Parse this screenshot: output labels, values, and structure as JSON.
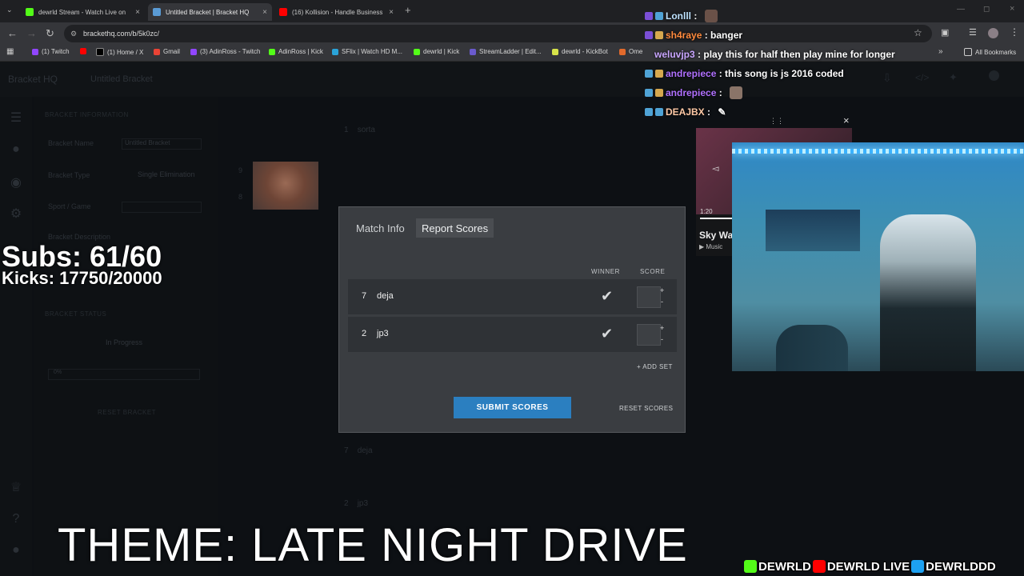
{
  "browser": {
    "tabs": [
      {
        "label": "dewrld Stream - Watch Live on",
        "color": "#53fc18"
      },
      {
        "label": "Untitled Bracket | Bracket HQ",
        "color": "#5a9bd5"
      },
      {
        "label": "(16) Kollision - Handle Business",
        "color": "#ff0000"
      }
    ],
    "url": "brackethq.com/b/5k0zc/",
    "bookmarks": [
      "(1) Twitch",
      "(1) Home / X",
      "Gmail",
      "(3) AdinRoss - Twitch",
      "AdinRoss | Kick",
      "SFlix | Watch HD M...",
      "dewrld | Kick",
      "StreamLadder | Edit...",
      "dewrld - KickBot",
      "Ome",
      "All Bookmarks"
    ]
  },
  "app": {
    "logo": "Bracket HQ",
    "title": "Untitled Bracket",
    "info_heading": "BRACKET INFORMATION",
    "fields": [
      {
        "label": "Bracket Name",
        "value": "Untitled Bracket"
      },
      {
        "label": "Bracket Type",
        "value": "Single Elimination"
      },
      {
        "label": "Sport / Game",
        "value": ""
      },
      {
        "label": "Bracket Description",
        "value": ""
      }
    ],
    "status_heading": "BRACKET STATUS",
    "status_value": "In Progress",
    "progress": "0%",
    "reset_bracket": "RESET BRACKET",
    "bg_matches": [
      {
        "seed": "1",
        "name": "sorta"
      },
      {
        "seed": "9",
        "name": ""
      },
      {
        "seed": "8",
        "name": ""
      },
      {
        "seed": "7",
        "name": "deja"
      },
      {
        "seed": "2",
        "name": "jp3"
      }
    ]
  },
  "modal": {
    "tabs": [
      "Match Info",
      "Report Scores"
    ],
    "active_tab": 1,
    "winner_header": "WINNER",
    "score_header": "SCORE",
    "rows": [
      {
        "seed": "7",
        "name": "deja"
      },
      {
        "seed": "2",
        "name": "jp3"
      }
    ],
    "add_set": "+ ADD SET",
    "submit": "SUBMIT SCORES",
    "reset": "RESET SCORES"
  },
  "overlay": {
    "subs": "Subs: 61/60",
    "kicks": "Kicks: 17750/20000",
    "theme": "THEME: LATE NIGHT DRIVE",
    "chat": [
      {
        "user": "Lonlll",
        "color": "#bfe3ff",
        "msg": ""
      },
      {
        "user": "sh4raye",
        "color": "#ff8a3d",
        "msg": "banger"
      },
      {
        "user": "weluvjp3",
        "color": "#c9a6ff",
        "msg": "play this for half then play mine for longer"
      },
      {
        "user": "andrepiece",
        "color": "#b070ff",
        "msg": "this song is js 2016 coded"
      },
      {
        "user": "andrepiece",
        "color": "#b070ff",
        "msg": ""
      },
      {
        "user": "DEAJBX",
        "color": "#ffc9a6",
        "msg": ""
      }
    ],
    "music": {
      "time": "1:20",
      "title": "Sky Wa",
      "source": "Music"
    },
    "socials": [
      "DEWRLD",
      "DEWRLD LIVE",
      "DEWRLDDD"
    ]
  }
}
